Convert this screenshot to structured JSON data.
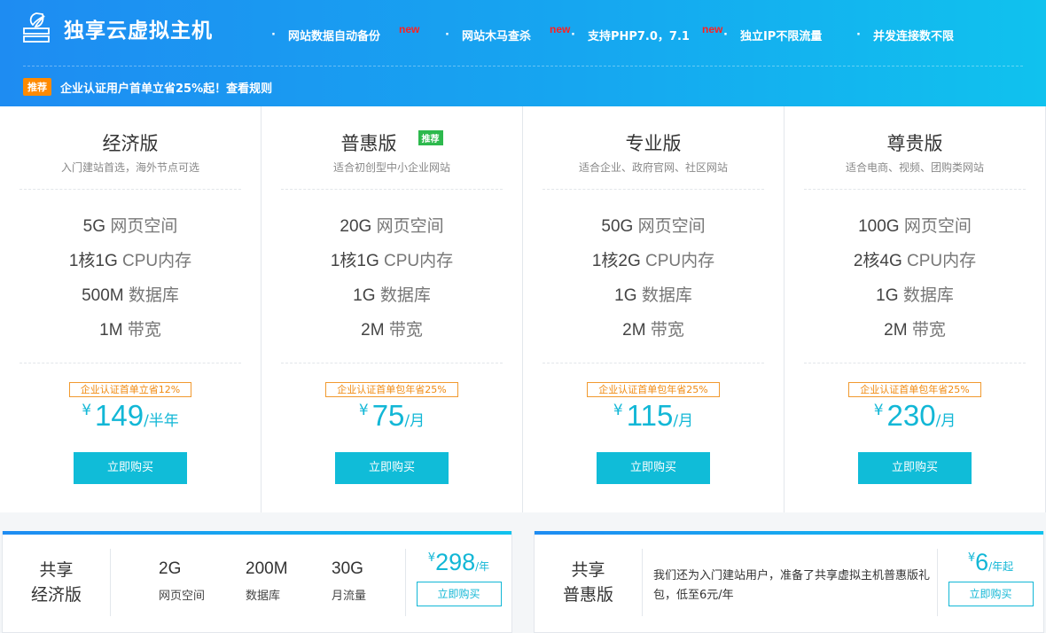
{
  "header": {
    "brand_title": "独享云虚拟主机",
    "features": [
      {
        "label": "网站数据自动备份",
        "badge": "new"
      },
      {
        "label": "网站木马查杀",
        "badge": "new"
      },
      {
        "label": "支持PHP7.0，7.1",
        "badge": "new"
      },
      {
        "label": "独立IP不限流量",
        "badge": ""
      },
      {
        "label": "并发连接数不限",
        "badge": ""
      }
    ],
    "feature_bullet": "·",
    "promo_tag": "推荐",
    "promo_text": "企业认证用户首单立省25%起！查看规则"
  },
  "plans": [
    {
      "name": "经济版",
      "tag": "",
      "subtitle": "入门建站首选，海外节点可选",
      "specs": [
        {
          "value": "5G",
          "unit": "网页空间"
        },
        {
          "value": "1核1G",
          "unit": "CPU内存"
        },
        {
          "value": "500M",
          "unit": "数据库"
        },
        {
          "value": "1M",
          "unit": "带宽"
        }
      ],
      "discount": "企业认证首单立省12%",
      "currency": "¥",
      "price": "149",
      "period": "/半年",
      "buy_label": "立即购买"
    },
    {
      "name": "普惠版",
      "tag": "推荐",
      "subtitle": "适合初创型中小企业网站",
      "specs": [
        {
          "value": "20G",
          "unit": "网页空间"
        },
        {
          "value": "1核1G",
          "unit": "CPU内存"
        },
        {
          "value": "1G",
          "unit": "数据库"
        },
        {
          "value": "2M",
          "unit": "带宽"
        }
      ],
      "discount": "企业认证首单包年省25%",
      "currency": "¥",
      "price": "75",
      "period": "/月",
      "buy_label": "立即购买"
    },
    {
      "name": "专业版",
      "tag": "",
      "subtitle": "适合企业、政府官网、社区网站",
      "specs": [
        {
          "value": "50G",
          "unit": "网页空间"
        },
        {
          "value": "1核2G",
          "unit": "CPU内存"
        },
        {
          "value": "1G",
          "unit": "数据库"
        },
        {
          "value": "2M",
          "unit": "带宽"
        }
      ],
      "discount": "企业认证首单包年省25%",
      "currency": "¥",
      "price": "115",
      "period": "/月",
      "buy_label": "立即购买"
    },
    {
      "name": "尊贵版",
      "tag": "",
      "subtitle": "适合电商、视频、团购类网站",
      "specs": [
        {
          "value": "100G",
          "unit": "网页空间"
        },
        {
          "value": "2核4G",
          "unit": "CPU内存"
        },
        {
          "value": "1G",
          "unit": "数据库"
        },
        {
          "value": "2M",
          "unit": "带宽"
        }
      ],
      "discount": "企业认证首单包年省25%",
      "currency": "¥",
      "price": "230",
      "period": "/月",
      "buy_label": "立即购买"
    }
  ],
  "shared_economy": {
    "name_line1": "共享",
    "name_line2": "经济版",
    "stats": [
      {
        "value": "2G",
        "label": "网页空间"
      },
      {
        "value": "200M",
        "label": "数据库"
      },
      {
        "value": "30G",
        "label": "月流量"
      }
    ],
    "currency": "¥",
    "price": "298",
    "period": "/年",
    "buy_label": "立即购买"
  },
  "shared_puhui": {
    "name_line1": "共享",
    "name_line2": "普惠版",
    "description": "我们还为入门建站用户，准备了共享虚拟主机普惠版礼包，低至6元/年",
    "currency": "¥",
    "price": "6",
    "period": "/年起",
    "buy_label": "立即购买"
  }
}
